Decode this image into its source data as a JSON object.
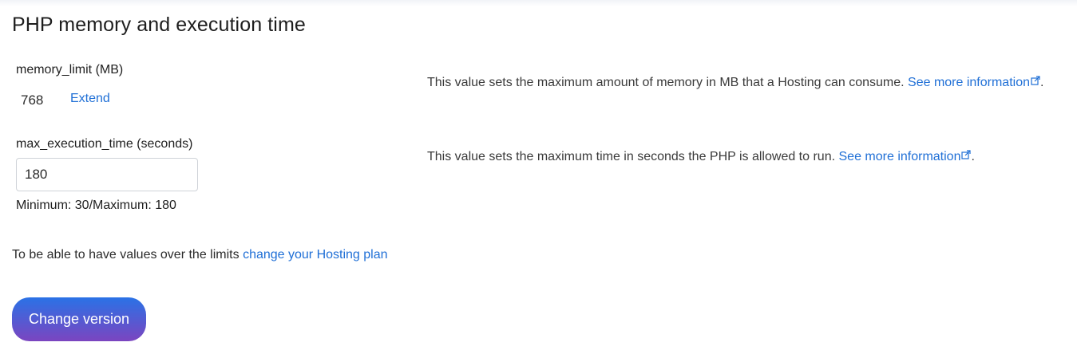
{
  "section": {
    "title": "PHP memory and execution time"
  },
  "memory_limit": {
    "label": "memory_limit (MB)",
    "value": "768",
    "extend_link": "Extend",
    "description": "This value sets the maximum amount of memory in MB that a Hosting can consume.",
    "more_info_link": "See more information",
    "description_end": "."
  },
  "max_execution_time": {
    "label": "max_execution_time (seconds)",
    "input_value": "180",
    "hint": "Minimum: 30/Maximum: 180",
    "description": "This value sets the maximum time in seconds the PHP is allowed to run.",
    "more_info_link": "See more information",
    "description_end": "."
  },
  "limits_note": {
    "text": "To be able to have values over the limits",
    "link": "change your Hosting plan"
  },
  "actions": {
    "change_version_label": "Change version"
  },
  "icons": {
    "external_link": "external-link-icon"
  },
  "colors": {
    "link": "#1f6fd6",
    "button_gradient_start": "#2a72e6",
    "button_gradient_end": "#7b45c0"
  }
}
